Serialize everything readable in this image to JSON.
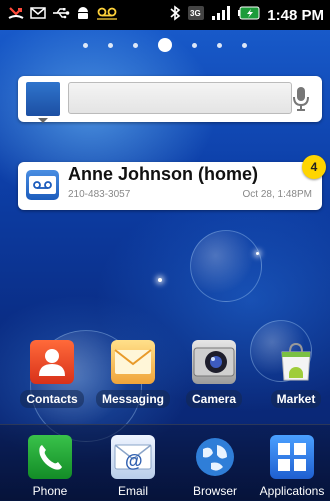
{
  "status_bar": {
    "time": "1:48 PM",
    "left_icons": [
      "missed-call-icon",
      "message-icon",
      "usb-icon",
      "android-debug-icon",
      "voicemail-icon"
    ],
    "right_icons": [
      "bluetooth-icon",
      "3g-icon",
      "signal-icon",
      "battery-icon"
    ]
  },
  "home": {
    "page_count": 7,
    "active_page": 4
  },
  "search_widget": {
    "placeholder": ""
  },
  "voicemail": {
    "name": "Anne  Johnson (home)",
    "number": "210-483-3057",
    "date": "Oct 28, 1:48PM",
    "badge": "4"
  },
  "apps": [
    {
      "label": "Contacts"
    },
    {
      "label": "Messaging"
    },
    {
      "label": "Camera"
    },
    {
      "label": "Market"
    }
  ],
  "dock": [
    {
      "label": "Phone"
    },
    {
      "label": "Email"
    },
    {
      "label": "Browser"
    },
    {
      "label": "Applications"
    }
  ],
  "colors": {
    "wallpaper": "#0d3fa8",
    "badge": "#ffd500",
    "status_bar": "#000000"
  }
}
